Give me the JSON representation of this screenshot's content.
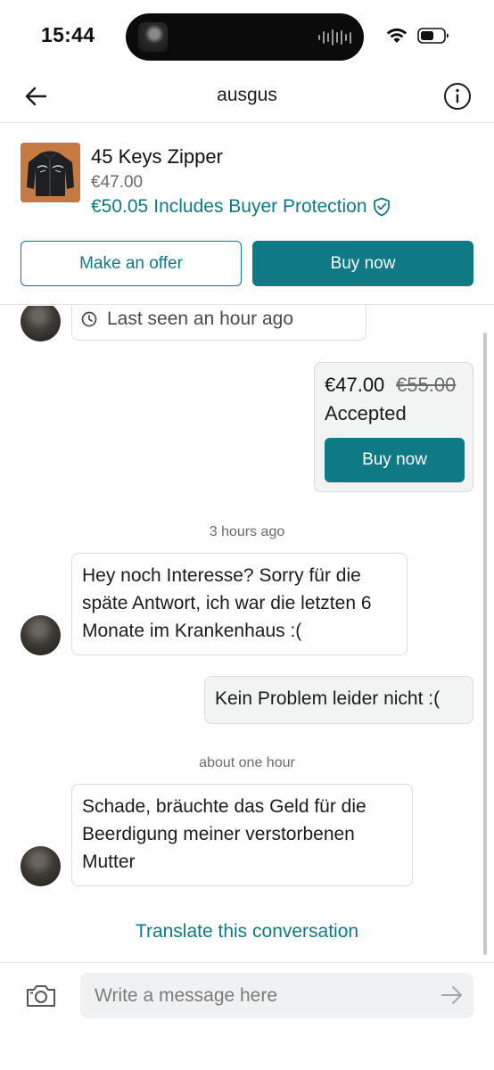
{
  "status_bar": {
    "time": "15:44",
    "icons": [
      "island-album-art",
      "island-waveform-icon",
      "wifi-icon",
      "battery-icon"
    ]
  },
  "header": {
    "title": "ausgus",
    "icons": [
      "back-arrow-icon",
      "info-icon"
    ]
  },
  "item": {
    "title": "45 Keys Zipper",
    "price": "€47.00",
    "total_price": "€50.05",
    "protection_label": "Includes Buyer Protection",
    "protection_icon": "shield-check-icon",
    "make_offer_label": "Make an offer",
    "buy_now_label": "Buy now"
  },
  "chat": {
    "last_seen": "Last seen an hour ago",
    "last_seen_icon": "clock-icon",
    "offer": {
      "price": "€47.00",
      "original_price": "€55.00",
      "status": "Accepted",
      "buy_label": "Buy now"
    },
    "separators": [
      "3 hours ago",
      "about one hour"
    ],
    "messages": [
      {
        "from": "other",
        "text": "Hey noch Interesse? Sorry für die späte Antwort, ich war die letzten 6 Monate im Krankenhaus :("
      },
      {
        "from": "me",
        "text": "Kein Problem leider nicht :("
      },
      {
        "from": "other",
        "text": "Schade, bräuchte das Geld für die Beerdigung meiner verstorbenen Mutter"
      }
    ],
    "translate_label": "Translate this conversation"
  },
  "composer": {
    "placeholder": "Write a message here",
    "icons": [
      "camera-icon",
      "send-arrow-icon"
    ]
  },
  "colors": {
    "accent": "#0f7a85",
    "bubble_me": "#f2f3f3",
    "border": "#dcdcdc",
    "muted_text": "#6b6b6b"
  }
}
